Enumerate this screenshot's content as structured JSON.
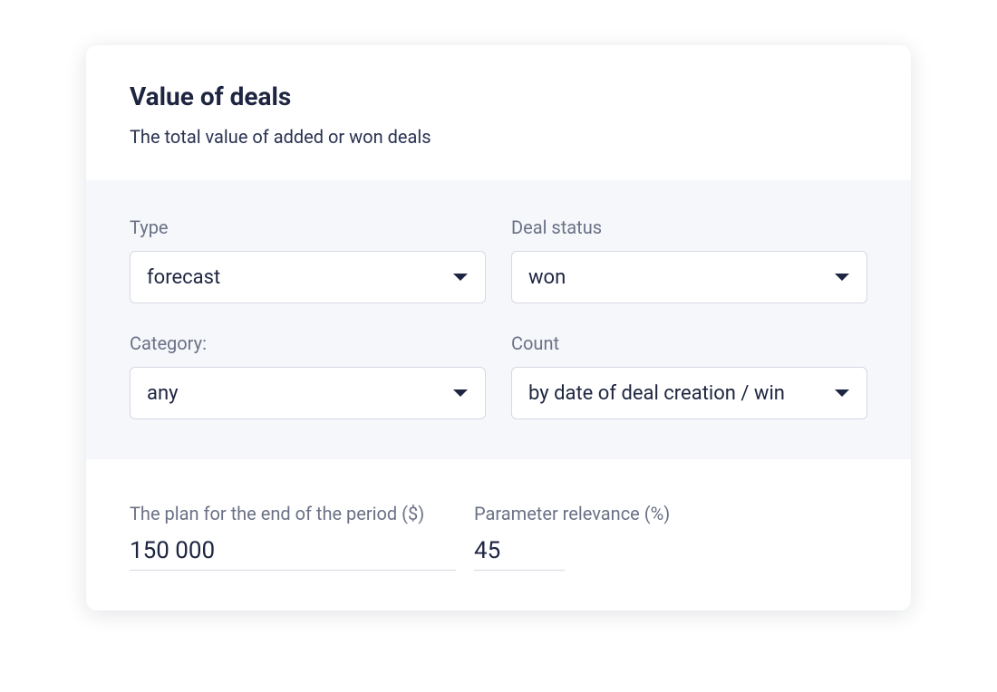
{
  "header": {
    "title": "Value of deals",
    "subtitle": "The total value of added or won deals"
  },
  "filters": {
    "type": {
      "label": "Type",
      "value": "forecast"
    },
    "dealStatus": {
      "label": "Deal status",
      "value": "won"
    },
    "category": {
      "label": "Category:",
      "value": "any"
    },
    "count": {
      "label": "Count",
      "value": "by date of deal creation / win"
    }
  },
  "plan": {
    "endOfPeriod": {
      "label": "The plan for the end of the period ($)",
      "value": "150 000"
    },
    "relevance": {
      "label": "Parameter relevance (%)",
      "value": "45"
    }
  }
}
